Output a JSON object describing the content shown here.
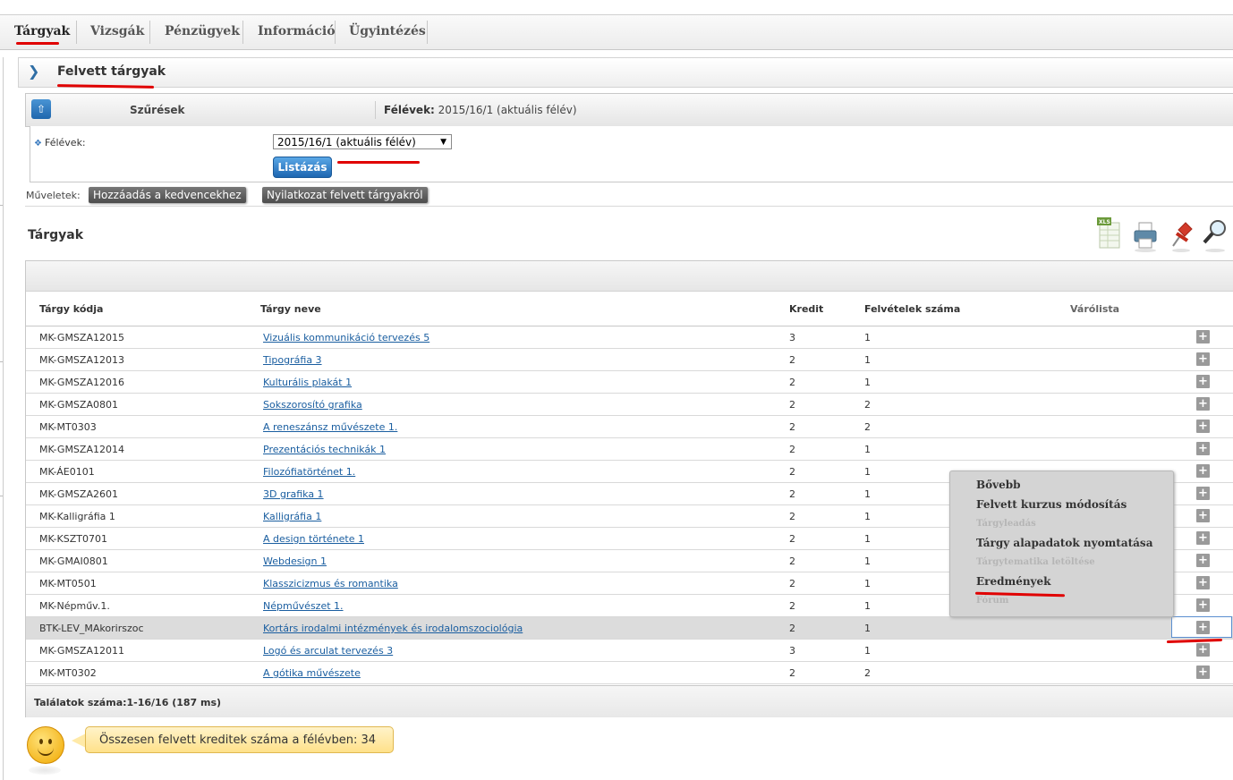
{
  "nav": {
    "items": [
      "Tárgyak",
      "Vizsgák",
      "Pénzügyek",
      "Információ",
      "Ügyintézés"
    ],
    "active": "Tárgyak"
  },
  "page": {
    "title": "Felvett tárgyak"
  },
  "filter": {
    "title": "Szűrések",
    "summary_label": "Félévek:",
    "summary_value": "2015/16/1 (aktuális félév)",
    "field_label": "Félévek:",
    "select_value": "2015/16/1 (aktuális félév)",
    "list_button": "Listázás"
  },
  "operations": {
    "label": "Műveletek:",
    "buttons": [
      "Hozzáadás a kedvencekhez",
      "Nyilatkozat felvett tárgyakról"
    ]
  },
  "section": {
    "title": "Tárgyak"
  },
  "toolbar_icons": [
    "xls-export-icon",
    "print-icon",
    "pin-icon",
    "search-icon"
  ],
  "table": {
    "columns": [
      "Tárgy kódja",
      "Tárgy neve",
      "Kredit",
      "Felvételek száma",
      "Várólista"
    ],
    "rows": [
      {
        "code": "MK-GMSZA12015",
        "name": "Vizuális kommunikáció tervezés 5",
        "credit": "3",
        "count": "1"
      },
      {
        "code": "MK-GMSZA12013",
        "name": "Tipográfia 3",
        "credit": "2",
        "count": "1"
      },
      {
        "code": "MK-GMSZA12016",
        "name": "Kulturális plakát 1",
        "credit": "2",
        "count": "1"
      },
      {
        "code": "MK-GMSZA0801",
        "name": "Sokszorosító grafika",
        "credit": "2",
        "count": "2"
      },
      {
        "code": "MK-MT0303",
        "name": "A reneszánsz művészete 1.",
        "credit": "2",
        "count": "2"
      },
      {
        "code": "MK-GMSZA12014",
        "name": "Prezentációs technikák 1",
        "credit": "2",
        "count": "1"
      },
      {
        "code": "MK-ÁE0101",
        "name": "Filozófiatörténet 1.",
        "credit": "2",
        "count": "1"
      },
      {
        "code": "MK-GMSZA2601",
        "name": "3D grafika 1",
        "credit": "2",
        "count": "1"
      },
      {
        "code": "MK-Kalligráfia 1",
        "name": "Kalligráfia 1",
        "credit": "2",
        "count": "1"
      },
      {
        "code": "MK-KSZT0701",
        "name": "A design története 1",
        "credit": "2",
        "count": "1"
      },
      {
        "code": "MK-GMAI0801",
        "name": "Webdesign 1",
        "credit": "2",
        "count": "1"
      },
      {
        "code": "MK-MT0501",
        "name": "Klasszicizmus és romantika",
        "credit": "2",
        "count": "1"
      },
      {
        "code": "MK-Népműv.1.",
        "name": "Népművészet 1.",
        "credit": "2",
        "count": "1"
      },
      {
        "code": "BTK-LEV_MAkorirszoc",
        "name": "Kortárs irodalmi intézmények és irodalomszociológia",
        "credit": "2",
        "count": "1",
        "highlighted": true
      },
      {
        "code": "MK-GMSZA12011",
        "name": "Logó és arculat tervezés 3",
        "credit": "3",
        "count": "1"
      },
      {
        "code": "MK-MT0302",
        "name": "A gótika művészete",
        "credit": "2",
        "count": "2"
      }
    ],
    "footer": "Találatok száma:1-16/16 (187 ms)"
  },
  "context_menu": {
    "items": [
      {
        "label": "Bővebb",
        "enabled": true
      },
      {
        "label": "Felvett kurzus módosítás",
        "enabled": true
      },
      {
        "label": "Tárgyleadás",
        "enabled": false
      },
      {
        "label": "Tárgy alapadatok nyomtatása",
        "enabled": true
      },
      {
        "label": "Tárgytematika letöltése",
        "enabled": false
      },
      {
        "label": "Eredmények",
        "enabled": true
      },
      {
        "label": "Fórum",
        "enabled": false
      }
    ]
  },
  "credits_bubble": "Összesen felvett kreditek száma a félévben: 34",
  "colors": {
    "accent": "#1d66b1",
    "annotation_red": "#e00000",
    "link": "#1a5ea0"
  }
}
